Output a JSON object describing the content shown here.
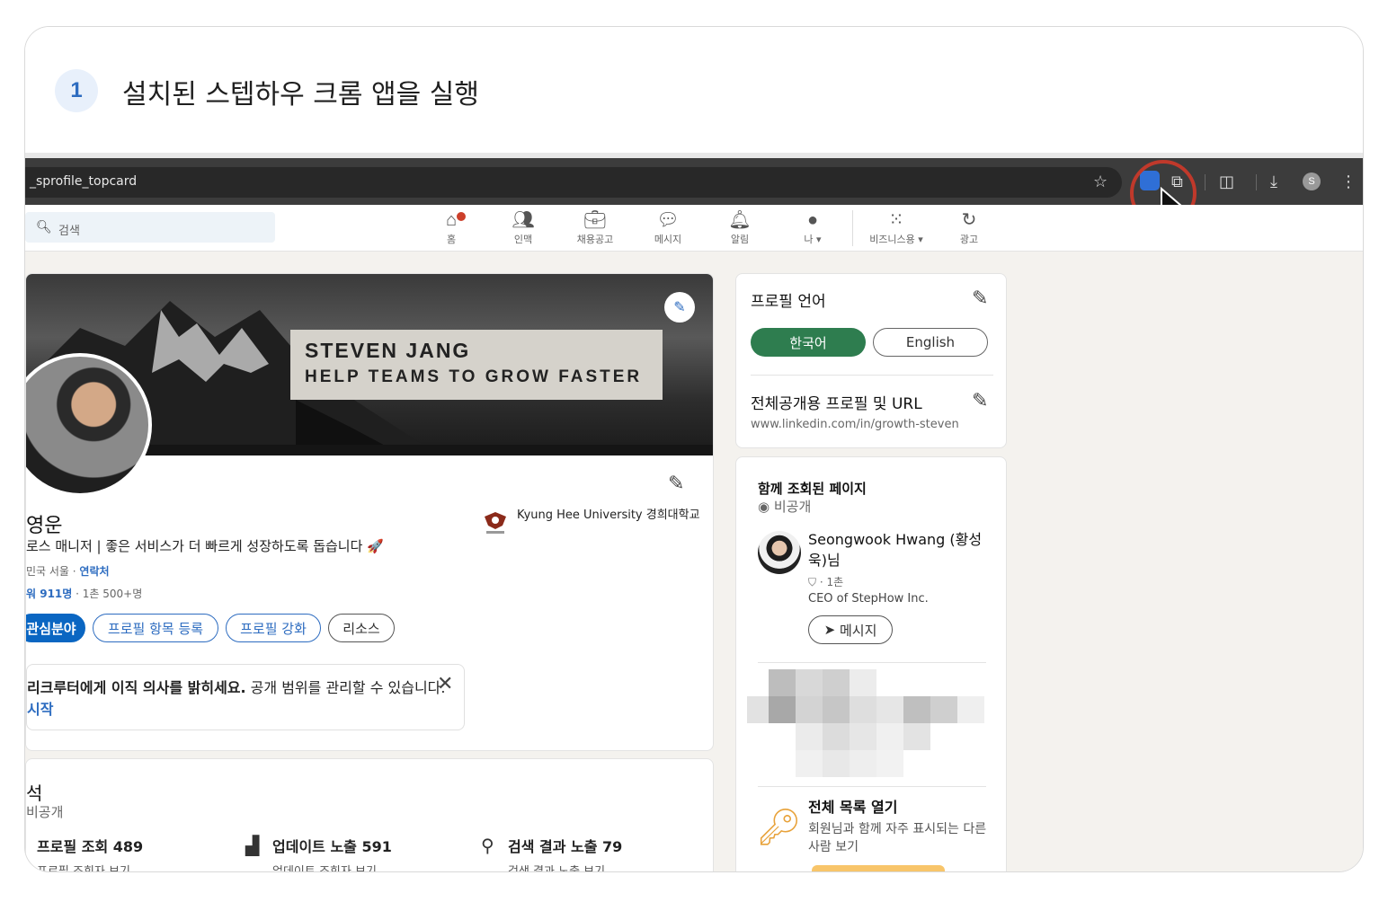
{
  "step": {
    "number": "1",
    "title": "설치된 스텝하우 크롬 앱을 실행"
  },
  "browser": {
    "url": "_sprofile_topcard",
    "icons": [
      "star-icon",
      "extension-app-icon",
      "puzzle-icon",
      "reading-list-icon",
      "download-icon",
      "profile-icon",
      "more-icon"
    ],
    "profile_initial": "S"
  },
  "linkedin_nav": {
    "search_placeholder": "검색",
    "items": [
      {
        "label": "홈",
        "icon": "home-icon"
      },
      {
        "label": "인맥",
        "icon": "network-icon"
      },
      {
        "label": "채용공고",
        "icon": "jobs-icon"
      },
      {
        "label": "메시지",
        "icon": "messaging-icon"
      },
      {
        "label": "알림",
        "icon": "bell-icon"
      },
      {
        "label": "나 ▾",
        "icon": "me-avatar"
      },
      {
        "label": "비즈니스용 ▾",
        "icon": "grid-icon"
      },
      {
        "label": "광고",
        "icon": "ads-icon"
      }
    ]
  },
  "profile": {
    "banner_name": "STEVEN JANG",
    "banner_tagline": "HELP TEAMS TO GROW FASTER",
    "name": "영운",
    "headline": "로스 매니저 | 좋은 서비스가 더 빠르게 성장하도록 돕습니다 🚀",
    "location": "민국 서울 · ",
    "contact_label": "연락처",
    "followers": "워 911명",
    "connections": " · 1촌 500+명",
    "school": "Kyung Hee University 경희대학교",
    "buttons": [
      "관심분야",
      "프로필 항목 등록",
      "프로필 강화",
      "리소스"
    ],
    "notice_bold": "리크루터에게 이직 의사를 밝히세요.",
    "notice_text": " 공개 범위를 관리할 수 있습니다.",
    "notice_link": "시작"
  },
  "analytics": {
    "title": "석",
    "subtitle": "비공개",
    "items": [
      {
        "label": "프로필 조회 489",
        "link": "프로필 조회자 보기",
        "icon": ""
      },
      {
        "label": "업데이트 노출 591",
        "link": "업데이트 조회자 보기",
        "icon": "bar-chart-icon"
      },
      {
        "label": "검색 결과 노출 79",
        "link": "검색 결과 노출 보기",
        "icon": "search-icon"
      }
    ]
  },
  "sidebar": {
    "lang_title": "프로필 언어",
    "lang_active": "한국어",
    "lang_other": "English",
    "public_title": "전체공개용 프로필 및 URL",
    "public_url": "www.linkedin.com/in/growth-steven",
    "viewed_title": "함께 조회된 페이지",
    "viewed_sub": "비공개",
    "person_name": "Seongwook Hwang (황성욱)님",
    "person_degree": "· 1촌",
    "person_job": "CEO of StepHow Inc.",
    "message_label": "메시지",
    "open_list_title": "전체 목록 열기",
    "open_list_sub": "회원님과 함께 자주 표시되는 다른 사람 보기"
  },
  "colors": {
    "accent": "#0a66c2",
    "active_lang": "#2e7d4f",
    "highlight_ring": "#c0392b"
  }
}
